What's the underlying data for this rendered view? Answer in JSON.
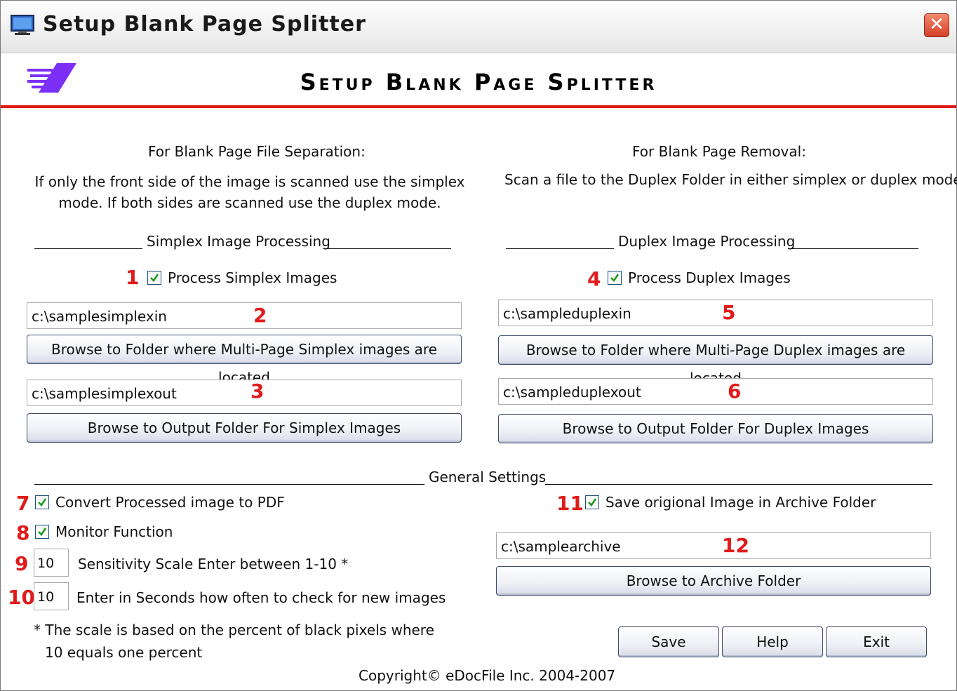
{
  "window": {
    "title": "Setup Blank Page Splitter",
    "close_icon": "close-icon"
  },
  "banner": {
    "title": "Setup Blank Page Splitter"
  },
  "left": {
    "heading": "For Blank Page File Separation:",
    "description": "If only the front side of the image is scanned use the simplex mode. If both sides are scanned use the duplex mode.",
    "section_title": "Simplex Image Processing",
    "process_checkbox_label": "Process Simplex Images",
    "input_folder": "c:\\samplesimplexin",
    "browse_input_label": "Browse to Folder where Multi-Page Simplex images are located",
    "output_folder": "c:\\samplesimplexout",
    "browse_output_label": "Browse to Output Folder For Simplex Images"
  },
  "right": {
    "heading": "For Blank Page Removal:",
    "description": "Scan a file to the Duplex Folder in either simplex or duplex mode",
    "section_title": "Duplex Image Processing",
    "process_checkbox_label": "Process Duplex Images",
    "input_folder": "c:\\sampleduplexin",
    "browse_input_label": "Browse to Folder where Multi-Page Duplex images are located",
    "output_folder": "c:\\sampleduplexout",
    "browse_output_label": "Browse to Output Folder For Duplex Images"
  },
  "general": {
    "section_title": "General Settings",
    "convert_pdf_label": "Convert Processed image to PDF",
    "monitor_label": "Monitor Function",
    "sensitivity_value": "10",
    "sensitivity_label": "Sensitivity Scale Enter between 1-10 *",
    "interval_value": "10",
    "interval_label": "Enter in Seconds how often to check for new images",
    "footnote_line1": "* The scale is based on the percent of black pixels where",
    "footnote_line2": "10 equals one percent",
    "archive_checkbox_label": "Save origional Image in Archive Folder",
    "archive_folder": "c:\\samplearchive",
    "browse_archive_label": "Browse to Archive Folder"
  },
  "buttons": {
    "save": "Save",
    "help": "Help",
    "exit": "Exit"
  },
  "copyright": "Copyright© eDocFile Inc. 2004-2007",
  "annotations": [
    "1",
    "2",
    "3",
    "4",
    "5",
    "6",
    "7",
    "8",
    "9",
    "10",
    "11",
    "12"
  ],
  "colors": {
    "accent_red": "#e11b1b",
    "logo_purple": "#7b2ff7",
    "checkmark_green": "#1a9a1a"
  }
}
